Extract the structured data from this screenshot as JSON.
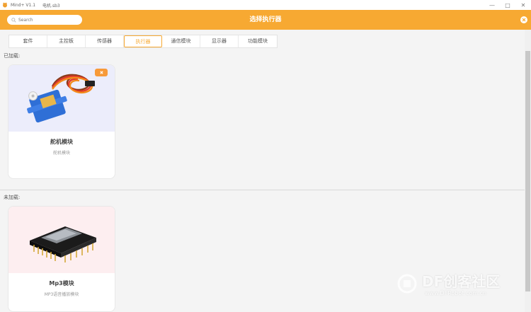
{
  "window": {
    "app_title": "Mind+ V1.1",
    "file_name": "电机.sb3",
    "controls": [
      "—",
      "□",
      "✕"
    ]
  },
  "header": {
    "title": "选择执行器",
    "search_placeholder": "Search",
    "background": "#f7a932"
  },
  "tabs": [
    {
      "label": "套件",
      "active": false
    },
    {
      "label": "主控板",
      "active": false
    },
    {
      "label": "传感器",
      "active": false
    },
    {
      "label": "执行器",
      "active": true
    },
    {
      "label": "通信模块",
      "active": false
    },
    {
      "label": "显示器",
      "active": false
    },
    {
      "label": "功能模块",
      "active": false
    }
  ],
  "loaded": {
    "label": "已加载:",
    "items": [
      {
        "title": "舵机模块",
        "subtitle": "舵机模块",
        "icon": "servo-image",
        "bg": "#ecedfb"
      }
    ]
  },
  "unloaded": {
    "label": "未加载:",
    "items": [
      {
        "title": "Mp3模块",
        "subtitle": "MP3语音播放模块",
        "icon": "mp3-module-image",
        "bg": "#fdeef0"
      }
    ]
  },
  "watermark": {
    "line1": "DF创客社区",
    "line2": "www.DFRobot.com.cn"
  }
}
